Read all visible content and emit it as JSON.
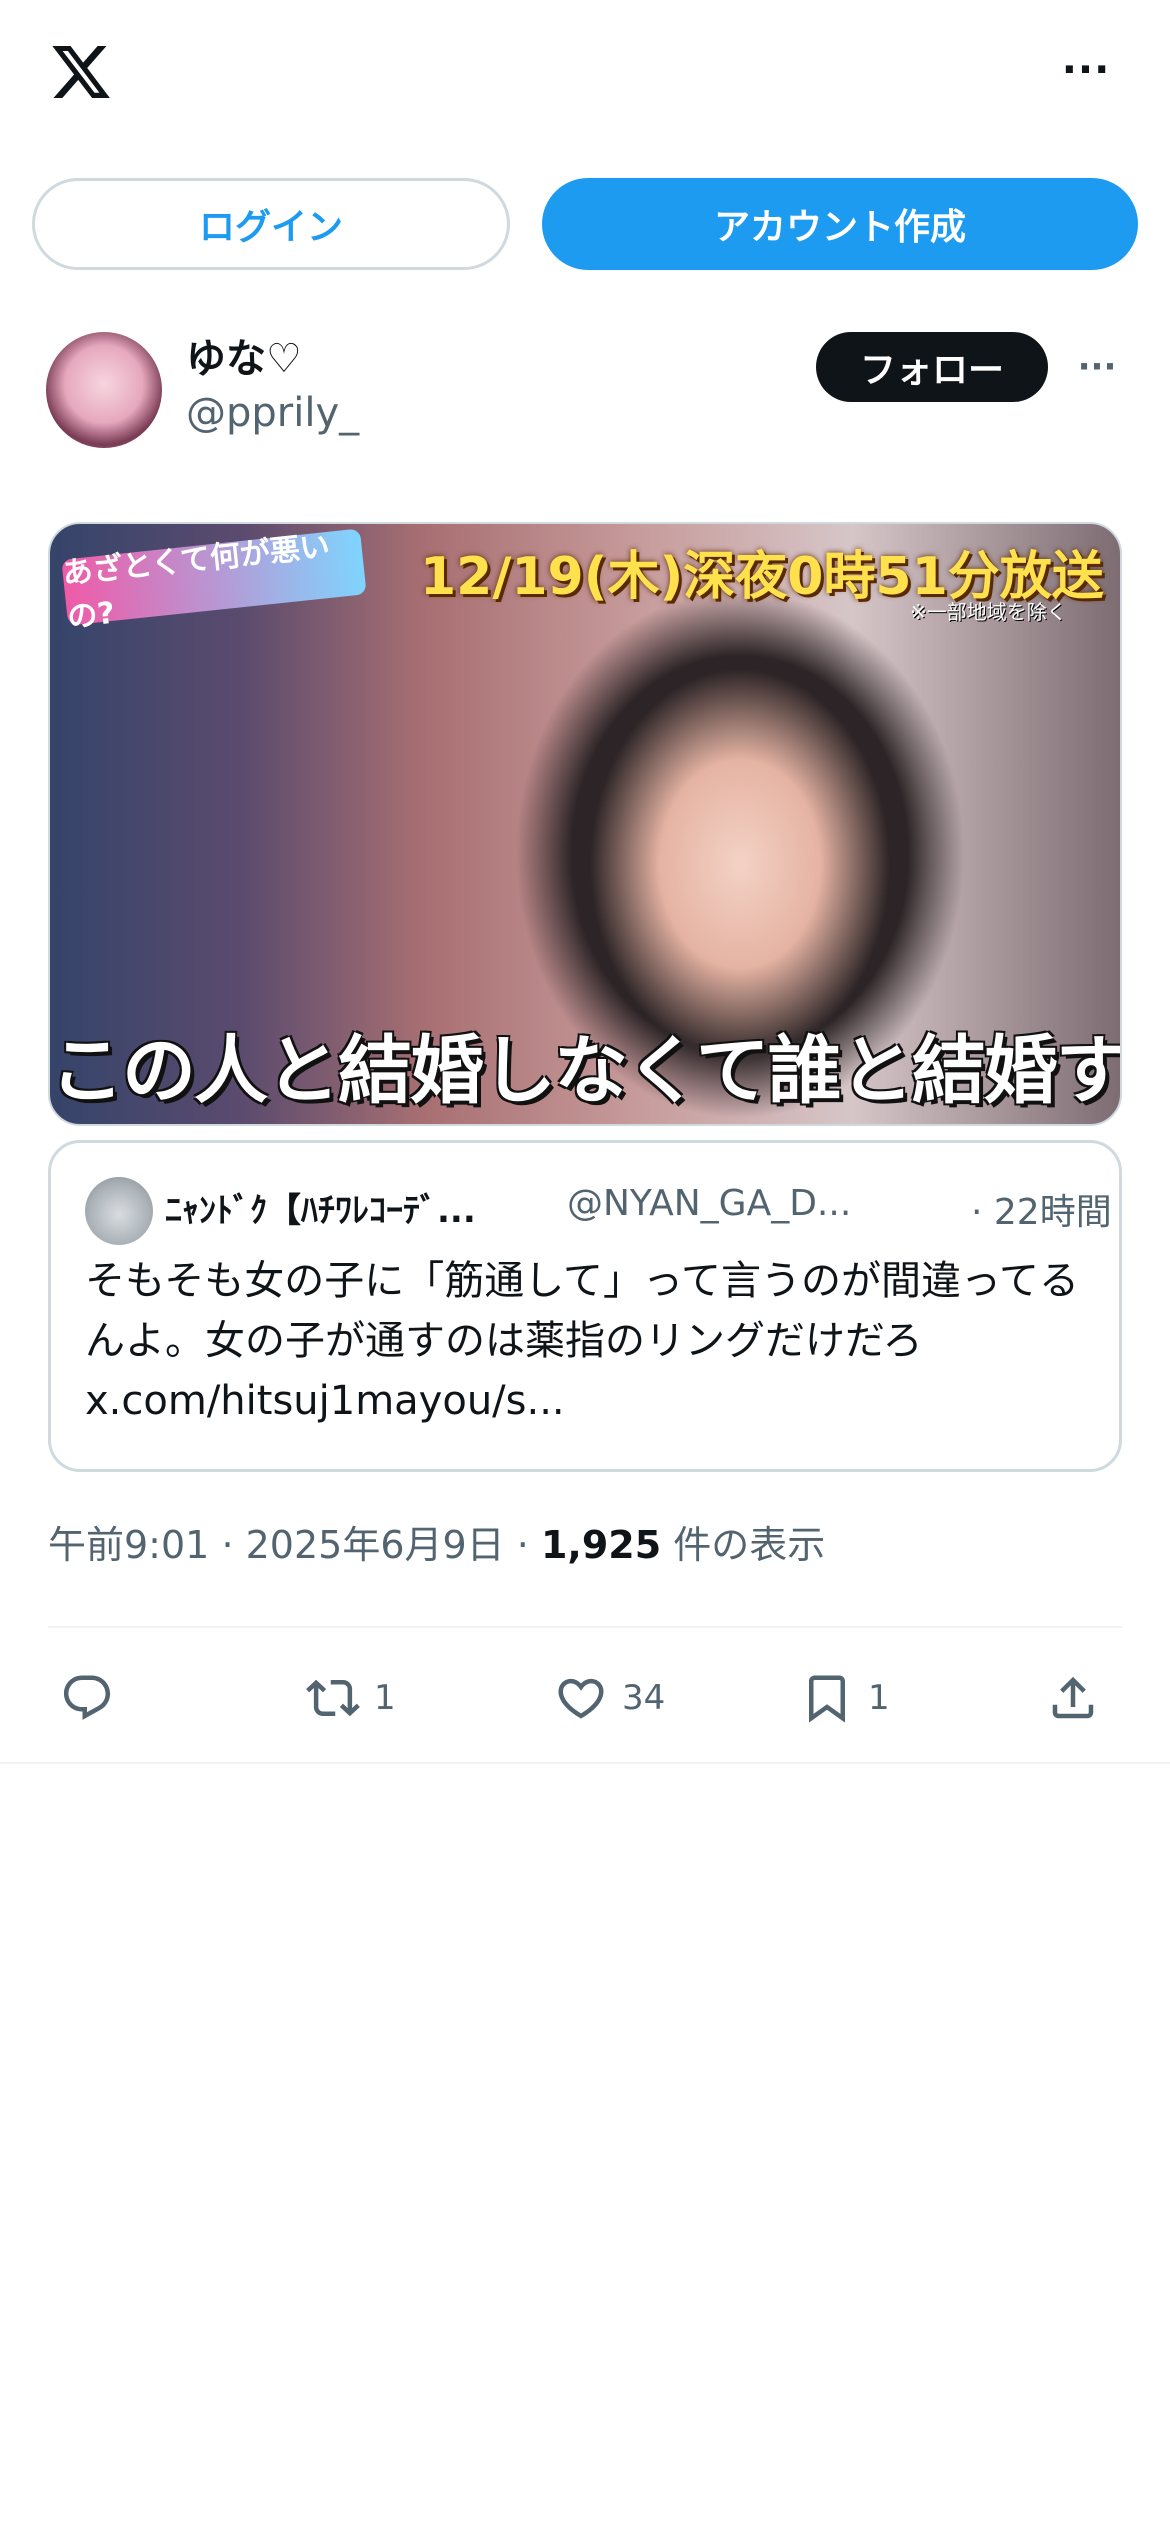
{
  "topbar": {
    "logo": "X",
    "more_label": "···"
  },
  "auth": {
    "login_label": "ログイン",
    "signup_label": "アカウント作成"
  },
  "colors": {
    "accent": "#1d9bf0",
    "text": "#0f1419",
    "secondary": "#536471",
    "border": "#cfd9de"
  },
  "post": {
    "display_name": "ゆな♡",
    "handle": "@pprily_",
    "follow_label": "フォロー",
    "more_label": "···",
    "media": {
      "logo_text": "あざとくて何が悪いの?",
      "banner": "12/19(木)深夜0時51分放送",
      "banner_sub": "※一部地域を除く",
      "caption": "この人と結婚しなくて誰と結婚するの?"
    },
    "quote": {
      "name": "ﾆｬﾝﾄﾞｸ【ﾊﾁﾜﾚｺｰﾃﾞ...",
      "handle": "@NYAN_GA_D...",
      "time": "· 22時間",
      "text": "そもそも女の子に「筋通して」って言うのが間違ってるんよ。女の子が通すのは薬指のリングだけだろ",
      "link": "x.com/hitsuj1mayou/s..."
    },
    "meta": {
      "time": "午前9:01",
      "sep": "·",
      "date": "2025年6月9日",
      "views": "1,925",
      "views_label": "件の表示"
    },
    "actions": {
      "reply_icon": "reply-icon",
      "retweet_count": "1",
      "like_count": "34",
      "bookmark_count": "1",
      "share_icon": "share-icon"
    }
  }
}
